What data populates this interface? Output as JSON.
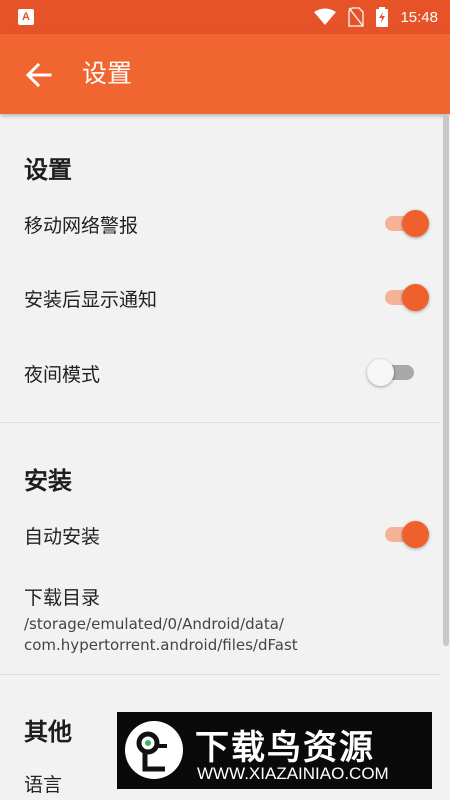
{
  "status_bar": {
    "time": "15:48",
    "app_icon": "A"
  },
  "app_bar": {
    "title": "设置",
    "back_icon": "arrow-left-icon"
  },
  "sections": {
    "settings": {
      "title": "设置",
      "items": [
        {
          "label": "移动网络警报",
          "enabled": true
        },
        {
          "label": "安装后显示通知",
          "enabled": true
        },
        {
          "label": "夜间模式",
          "enabled": false
        }
      ]
    },
    "install": {
      "title": "安装",
      "auto_install": {
        "label": "自动安装",
        "enabled": true
      },
      "download_dir": {
        "label": "下载目录",
        "path_line1": "/storage/emulated/0/Android/data/",
        "path_line2": "com.hypertorrent.android/files/dFast"
      }
    },
    "other": {
      "title": "其他",
      "language_label": "语言"
    }
  },
  "watermark": {
    "title": "下载鸟资源",
    "url": "WWW.XIAZAINIAO.COM"
  },
  "colors": {
    "status_bar": "#e65328",
    "app_bar": "#f06530",
    "accent": "#f0602c",
    "background": "#f2f2f2"
  }
}
